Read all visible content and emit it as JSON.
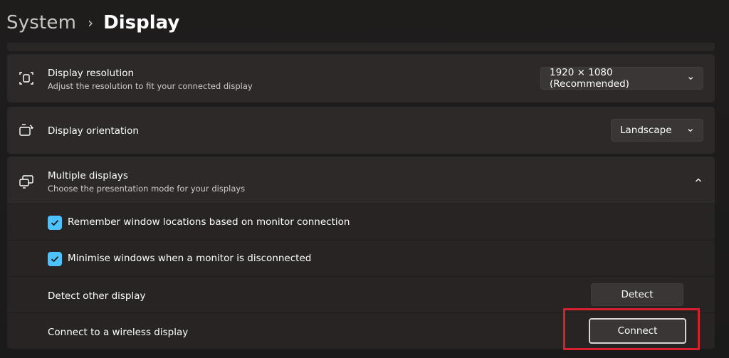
{
  "header": {
    "breadcrumb_parent": "System",
    "breadcrumb_separator": "›",
    "breadcrumb_current": "Display"
  },
  "resolution": {
    "title": "Display resolution",
    "subtitle": "Adjust the resolution to fit your connected display",
    "value": "1920 × 1080 (Recommended)",
    "icon": "resolution-icon"
  },
  "orientation": {
    "title": "Display orientation",
    "value": "Landscape",
    "icon": "orientation-icon"
  },
  "multiple": {
    "title": "Multiple displays",
    "subtitle": "Choose the presentation mode for your displays",
    "icon": "multiple-displays-icon",
    "expanded": true,
    "remember_label": "Remember window locations based on monitor connection",
    "remember_checked": true,
    "minimise_label": "Minimise windows when a monitor is disconnected",
    "minimise_checked": true,
    "detect_label": "Detect other display",
    "detect_button": "Detect",
    "connect_label": "Connect to a wireless display",
    "connect_button": "Connect"
  },
  "colors": {
    "accent": "#4cc2ff",
    "highlight": "#d6202b",
    "card": "#2c2928",
    "background": "#1c1a1a"
  }
}
